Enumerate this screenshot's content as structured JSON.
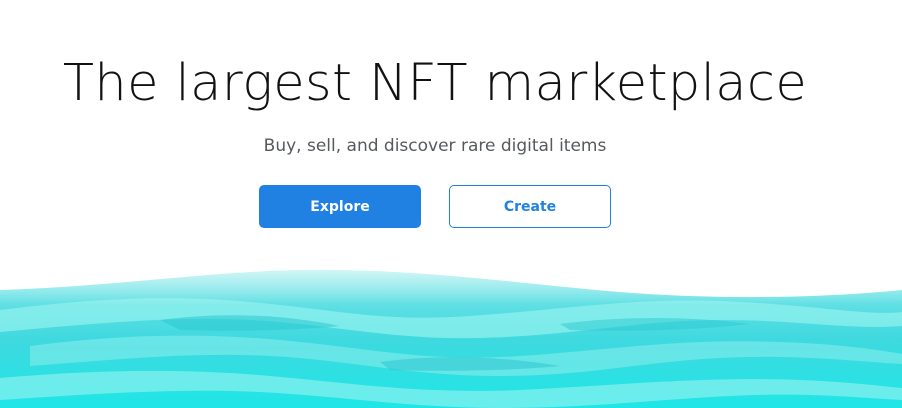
{
  "hero": {
    "title": "The largest NFT marketplace",
    "subtitle": "Buy, sell, and discover rare digital items"
  },
  "actions": {
    "explore_label": "Explore",
    "create_label": "Create"
  },
  "theme": {
    "accent": "#2081e2",
    "wave_light": "#8fe9ea",
    "wave_mid": "#3fd6dc",
    "wave_deep": "#22e4e4"
  },
  "illustration": {
    "name": "ocean-waves-illustration"
  }
}
